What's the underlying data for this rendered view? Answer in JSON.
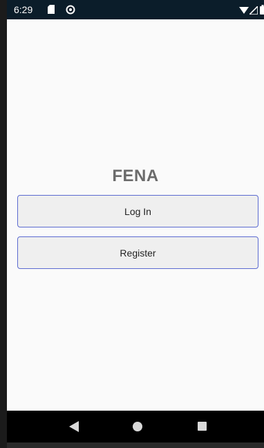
{
  "status_bar": {
    "time": "6:29",
    "icons": [
      "sd-card-icon",
      "do-not-disturb-icon",
      "wifi-icon",
      "signal-icon",
      "battery-icon"
    ]
  },
  "app": {
    "title": "FENA",
    "login_label": "Log In",
    "register_label": "Register"
  },
  "nav_bar": {
    "icons": [
      "back-icon",
      "home-icon",
      "recents-icon"
    ]
  },
  "colors": {
    "status_bar_bg": "#0b1d2a",
    "screen_bg": "#fafafa",
    "button_bg": "#efefef",
    "button_border": "#5b6ad0",
    "title_color": "#6b6b6b",
    "nav_bar_bg": "#000000"
  }
}
